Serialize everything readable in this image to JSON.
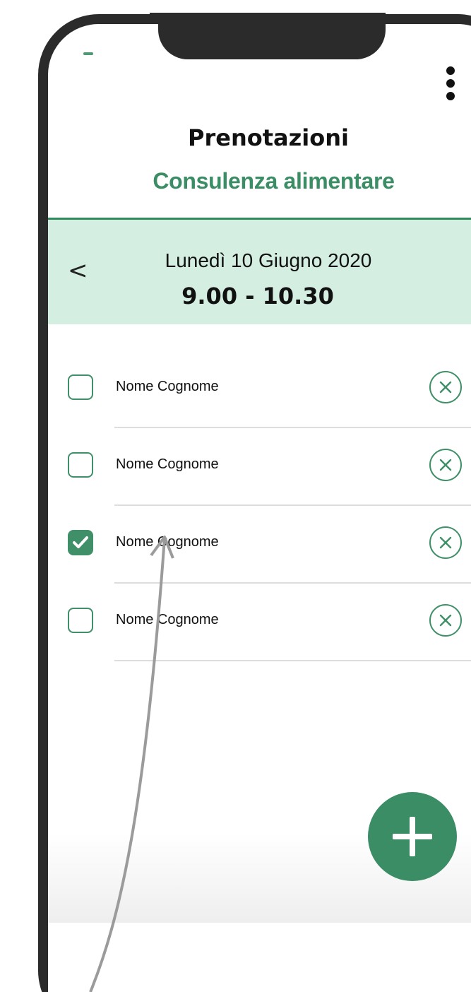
{
  "header": {
    "title": "Prenotazioni",
    "subtitle": "Consulenza alimentare"
  },
  "slot": {
    "date": "Lunedì 10 Giugno 2020",
    "time": "9.00 - 10.30"
  },
  "bookings": [
    {
      "name": "Nome Cognome",
      "checked": false
    },
    {
      "name": "Nome Cognome",
      "checked": false
    },
    {
      "name": "Nome Cognome",
      "checked": true
    },
    {
      "name": "Nome Cognome",
      "checked": false
    }
  ],
  "icons": {
    "menu": "kebab-menu-icon",
    "back": "chevron-left-icon",
    "remove": "close-circle-icon",
    "add": "plus-icon",
    "check": "check-icon"
  },
  "colors": {
    "accent": "#3a8d64",
    "band": "#d4efe2",
    "frame": "#2b2b2b"
  }
}
